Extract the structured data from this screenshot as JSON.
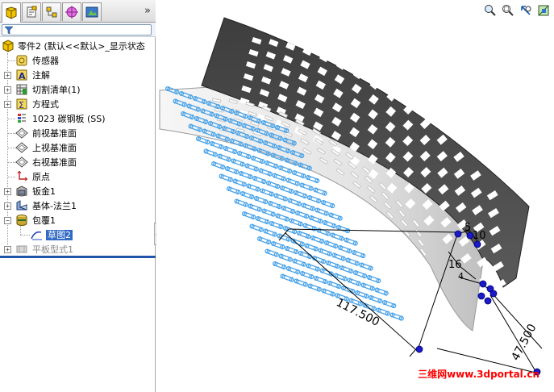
{
  "tabs": [
    {
      "name": "featuremanager-tab",
      "icon": "feature-tree-icon"
    },
    {
      "name": "propertymanager-tab",
      "icon": "property-icon"
    },
    {
      "name": "configurationmanager-tab",
      "icon": "configuration-icon"
    },
    {
      "name": "dimxpert-tab",
      "icon": "crosshair-icon"
    },
    {
      "name": "display-manager-tab",
      "icon": "display-icon"
    }
  ],
  "tabbar": {
    "more": "»"
  },
  "tree": {
    "root": "零件2  (默认<<默认>_显示状态",
    "items": [
      {
        "label": "传感器",
        "icon": "sensor-icon",
        "expand": ""
      },
      {
        "label": "注解",
        "icon": "annotation-icon",
        "expand": "+"
      },
      {
        "label": "切割清单(1)",
        "icon": "cutlist-icon",
        "expand": "+"
      },
      {
        "label": "方程式",
        "icon": "equation-icon",
        "expand": "+"
      },
      {
        "label": "1023 碳钢板 (SS)",
        "icon": "material-icon",
        "expand": ""
      },
      {
        "label": "前视基准面",
        "icon": "plane-icon",
        "expand": ""
      },
      {
        "label": "上视基准面",
        "icon": "plane-icon",
        "expand": ""
      },
      {
        "label": "右视基准面",
        "icon": "plane-icon",
        "expand": ""
      },
      {
        "label": "原点",
        "icon": "origin-icon",
        "expand": ""
      },
      {
        "label": "钣金1",
        "icon": "sheetmetal-icon",
        "expand": "+"
      },
      {
        "label": "基体-法兰1",
        "icon": "base-flange-icon",
        "expand": "+"
      },
      {
        "label": "包覆1",
        "icon": "wrap-icon",
        "expand": "−"
      },
      {
        "label": "草图2",
        "icon": "sketch-icon",
        "expand": ""
      },
      {
        "label": "平板型式1",
        "icon": "flat-pattern-icon",
        "expand": "+"
      }
    ]
  },
  "dimensions": {
    "length": "117.500",
    "width": "47.500",
    "d1": "10",
    "d2": "5",
    "d3": "16",
    "d4": "4"
  },
  "watermark": "三维网www.3dportal.cn",
  "colors": {
    "part_dark": "#4a4a4a",
    "part_light": "#e8e8e8",
    "sketch_blue": "#4aa3e8",
    "handle_blue": "#1a1acc",
    "watermark": "#ff0000",
    "selection": "#316ac5"
  }
}
